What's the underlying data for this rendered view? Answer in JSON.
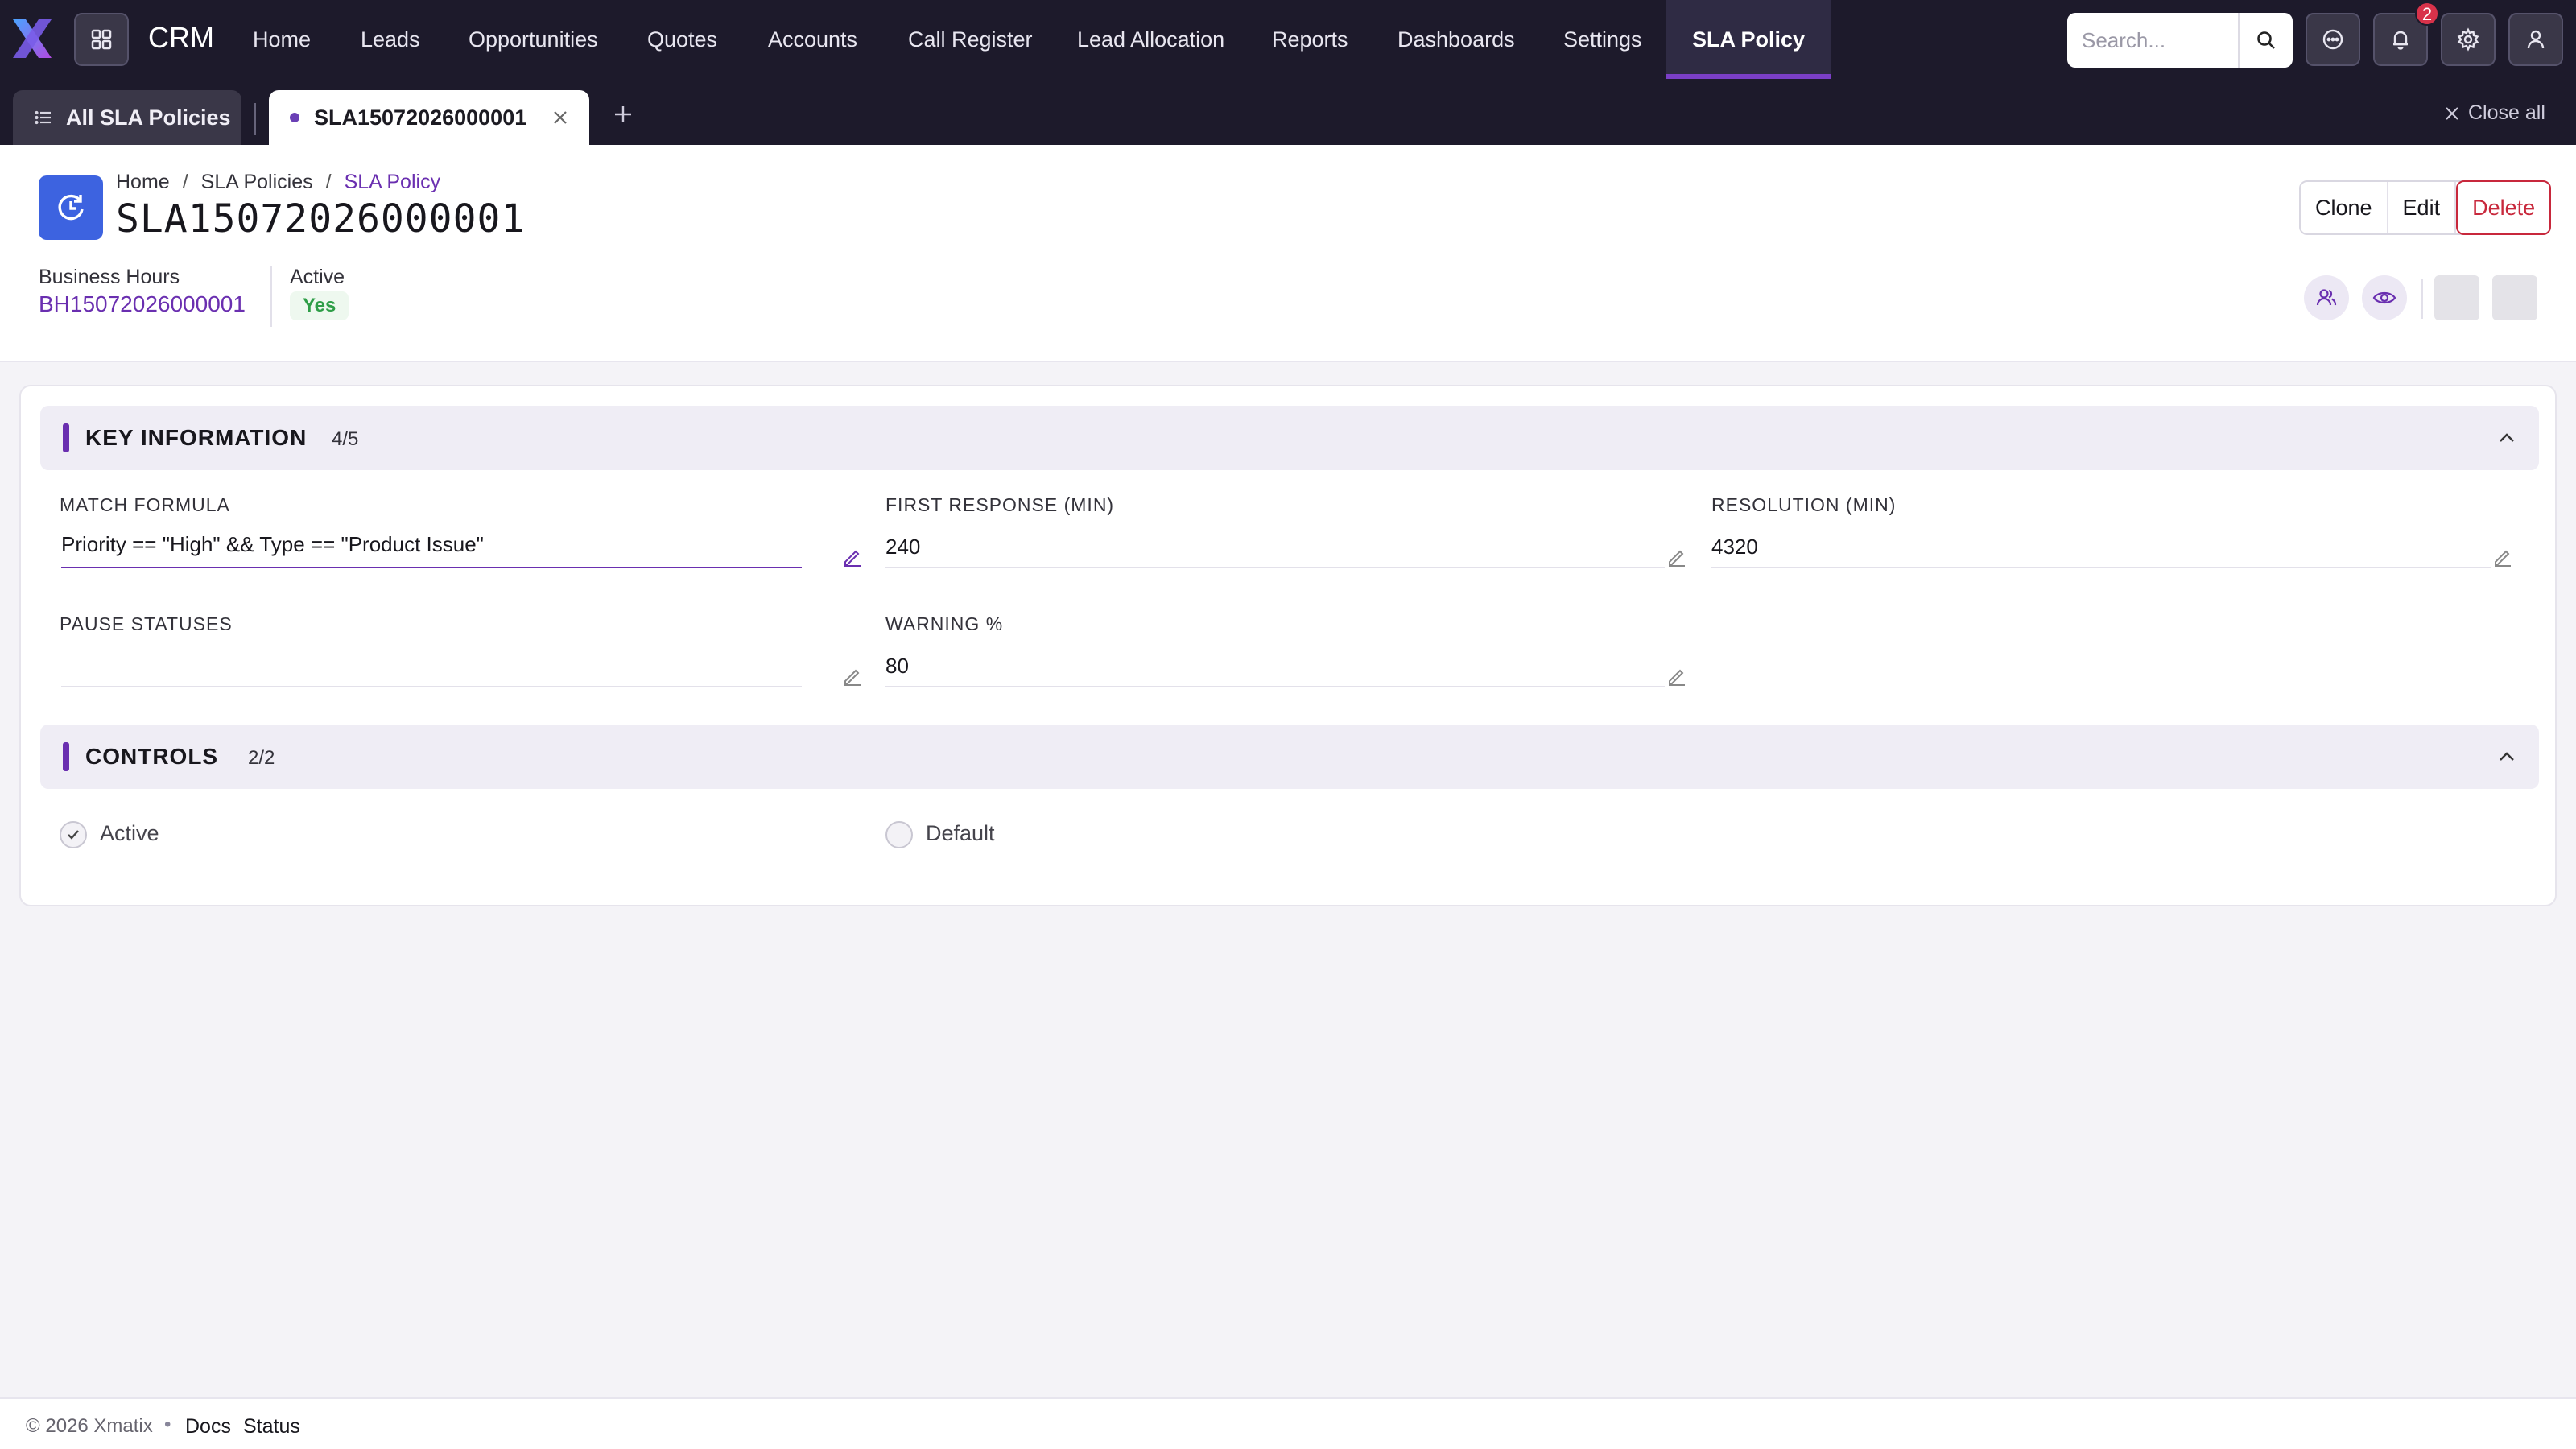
{
  "nav": {
    "brand": "CRM",
    "items": [
      {
        "label": "Home"
      },
      {
        "label": "Leads"
      },
      {
        "label": "Opportunities"
      },
      {
        "label": "Quotes"
      },
      {
        "label": "Accounts"
      },
      {
        "label": "Call Register"
      },
      {
        "label": "Lead Allocation"
      },
      {
        "label": "Reports"
      },
      {
        "label": "Dashboards"
      },
      {
        "label": "Settings"
      },
      {
        "label": "SLA Policy",
        "active": true
      }
    ],
    "search": {
      "placeholder": "Search...",
      "value": ""
    },
    "notification_count": "2",
    "icons": [
      "apps-grid-icon",
      "search-icon",
      "chat-icon",
      "bell-icon",
      "gear-icon",
      "user-icon"
    ]
  },
  "tabs": {
    "list_tab": "All SLA Policies",
    "record_tab": "SLA15072026000001",
    "close_all": "Close all"
  },
  "record": {
    "breadcrumb": [
      "Home",
      "SLA Policies",
      "SLA Policy"
    ],
    "title": "SLA15072026000001",
    "business_hours_label": "Business Hours",
    "business_hours_value": "BH15072026000001",
    "active_label": "Active",
    "active_value": "Yes",
    "actions": {
      "clone": "Clone",
      "edit": "Edit",
      "delete": "Delete"
    }
  },
  "sections": {
    "key_info": {
      "title": "KEY INFORMATION",
      "count": "4/5",
      "fields": {
        "match_formula": {
          "label": "MATCH FORMULA",
          "value": "Priority == \"High\" && Type == \"Product Issue\""
        },
        "first_response": {
          "label": "FIRST RESPONSE (MIN)",
          "value": "240"
        },
        "resolution": {
          "label": "RESOLUTION (MIN)",
          "value": "4320"
        },
        "pause_statuses": {
          "label": "PAUSE STATUSES",
          "value": ""
        },
        "warning": {
          "label": "WARNING %",
          "value": "80"
        }
      }
    },
    "controls": {
      "title": "CONTROLS",
      "count": "2/2",
      "active": {
        "label": "Active",
        "checked": true
      },
      "default": {
        "label": "Default",
        "checked": false
      }
    }
  },
  "footer": {
    "copyright": "© 2026 Xmatix",
    "links": [
      "Docs",
      "Status"
    ]
  },
  "colors": {
    "accent": "#6a2fb0",
    "nav_bg": "#1d1a2b",
    "danger": "#c8283c",
    "record_icon": "#3d63e0"
  }
}
